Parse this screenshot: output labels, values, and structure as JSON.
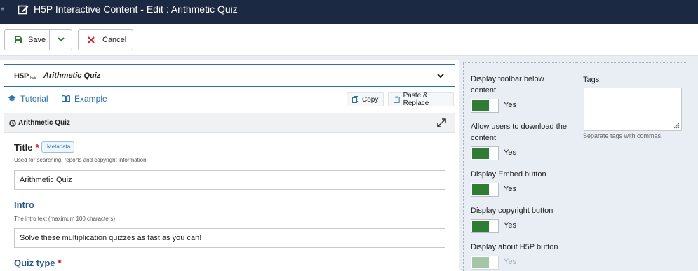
{
  "window": {
    "title": "H5P Interactive Content - Edit : Arithmetic Quiz",
    "menu_stub": "≡"
  },
  "toolbar": {
    "save_label": "Save",
    "cancel_label": "Cancel"
  },
  "library": {
    "logo_text": "H5P",
    "name": "Arithmetic Quiz"
  },
  "links": {
    "tutorial": "Tutorial",
    "example": "Example",
    "copy": "Copy",
    "paste_replace": "Paste & Replace"
  },
  "form": {
    "header": "Arithmetic Quiz",
    "title_label": "Title",
    "required_mark": "*",
    "metadata_badge": "Metadata",
    "title_desc": "Used for searching, reports and copyright information",
    "title_value": "Arithmetic Quiz",
    "intro_label": "Intro",
    "intro_desc": "The intro text (maximum 100 characters)",
    "intro_value": "Solve these multiplication quizzes as fast as you can!",
    "quiz_type_label": "Quiz type"
  },
  "settings": [
    {
      "label": "Display toolbar below content",
      "value": "Yes",
      "on": true,
      "disabled": false
    },
    {
      "label": "Allow users to download the content",
      "value": "Yes",
      "on": true,
      "disabled": false
    },
    {
      "label": "Display Embed button",
      "value": "Yes",
      "on": true,
      "disabled": false
    },
    {
      "label": "Display copyright button",
      "value": "Yes",
      "on": true,
      "disabled": false
    },
    {
      "label": "Display about H5P button",
      "value": "Yes",
      "on": true,
      "disabled": true
    }
  ],
  "tags": {
    "label": "Tags",
    "value": "",
    "help": "Separate tags with commas."
  },
  "colors": {
    "titlebar": "#1b2a42",
    "accent_blue": "#2a71a7",
    "toggle_on": "#2e7d32",
    "required": "#cc0000"
  }
}
